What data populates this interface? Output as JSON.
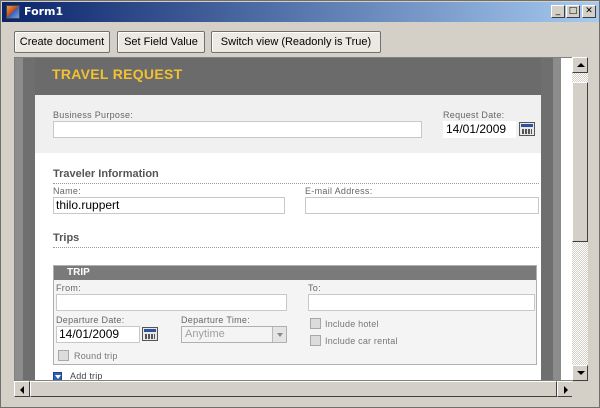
{
  "window": {
    "title": "Form1",
    "minimize_glyph": "_",
    "maximize_glyph": "□",
    "close_glyph": "✕"
  },
  "toolbar": {
    "create_document_label": "Create document",
    "set_field_value_label": "Set Field Value",
    "switch_view_label": "Switch view (Readonly is True)"
  },
  "form": {
    "title": "TRAVEL REQUEST",
    "business_purpose": {
      "label": "Business Purpose:",
      "value": ""
    },
    "request_date": {
      "label": "Request Date:",
      "value": "14/01/2009"
    },
    "traveler_section": "Traveler Information",
    "name": {
      "label": "Name:",
      "value": "thilo.ruppert"
    },
    "email": {
      "label": "E-mail Address:",
      "value": ""
    },
    "trips_section": "Trips",
    "trip": {
      "header": "TRIP",
      "from": {
        "label": "From:",
        "value": ""
      },
      "to": {
        "label": "To:",
        "value": ""
      },
      "departure_date": {
        "label": "Departure Date:",
        "value": "14/01/2009"
      },
      "departure_time": {
        "label": "Departure Time:",
        "value": "Anytime"
      },
      "include_hotel": {
        "label": "Include hotel",
        "checked": false
      },
      "include_car_rental": {
        "label": "Include car rental",
        "checked": false
      },
      "round_trip": {
        "label": "Round trip",
        "checked": false
      }
    },
    "add_trip_label": "Add trip"
  },
  "colors": {
    "title_accent": "#f2c030",
    "titlebar_start": "#0a246a",
    "titlebar_end": "#a6caf0",
    "trip_header": "#7a7a7a"
  }
}
